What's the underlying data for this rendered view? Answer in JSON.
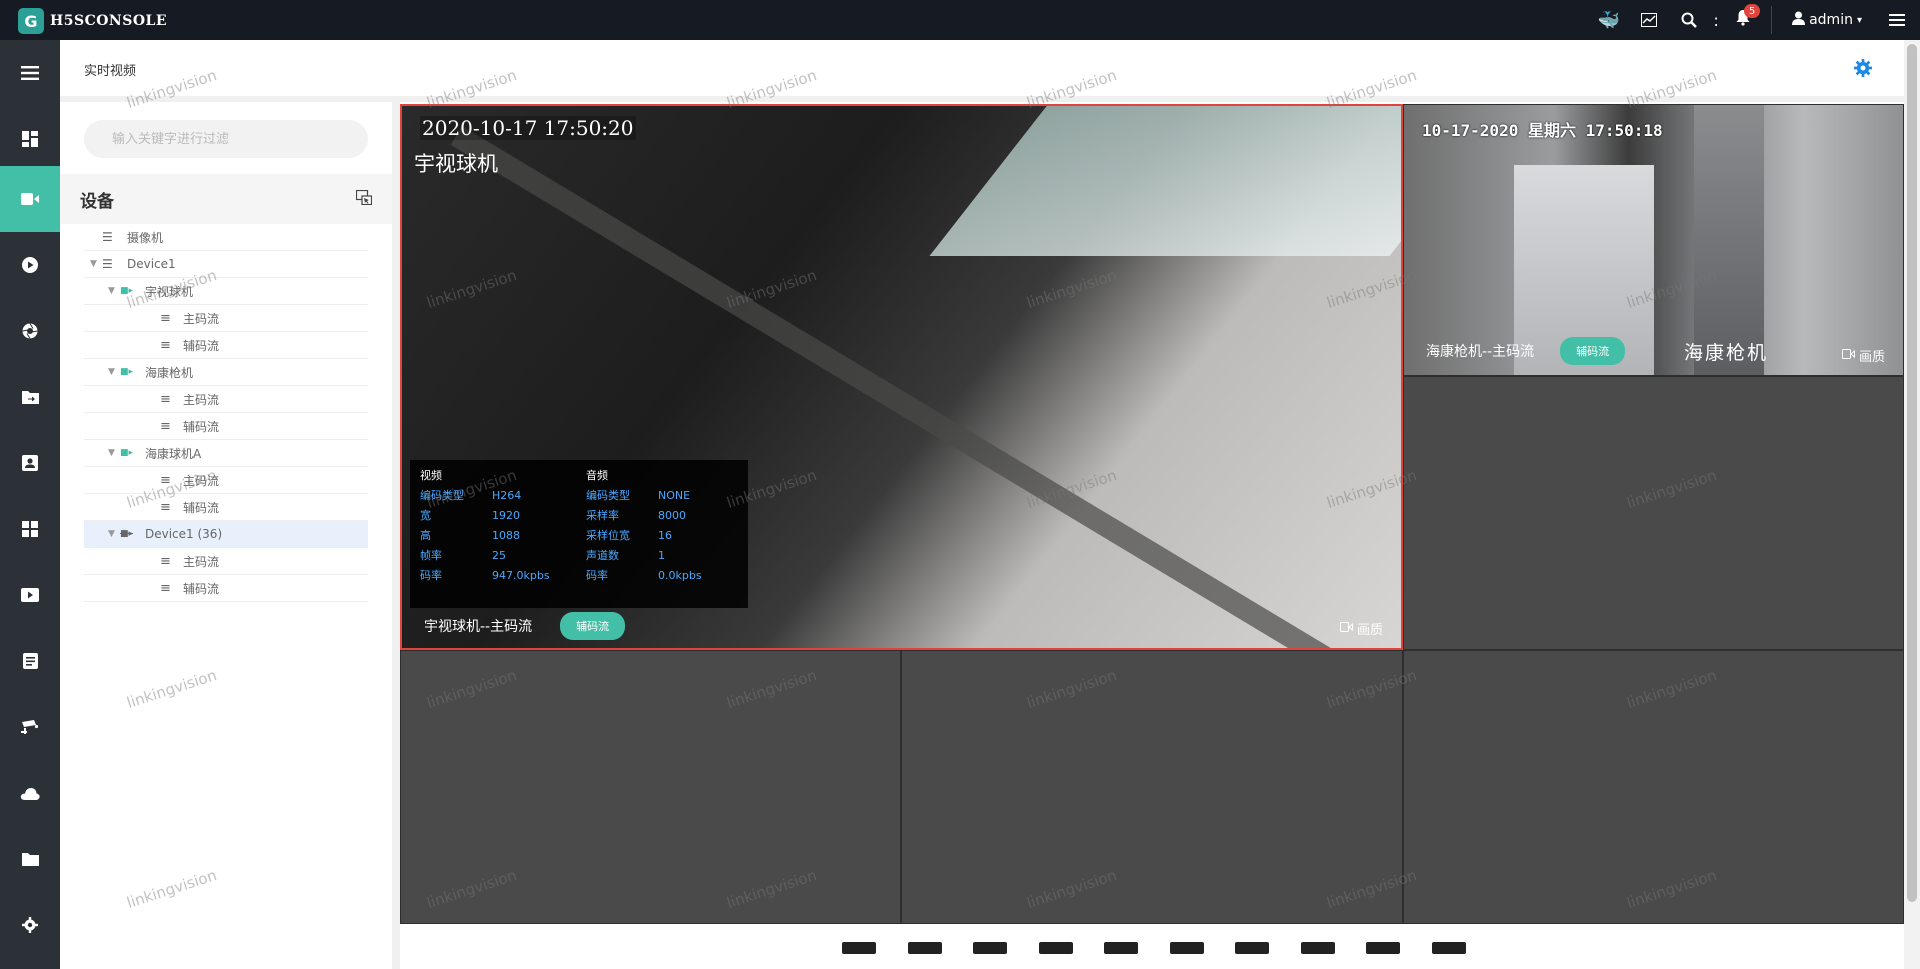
{
  "app": {
    "brand": "H5SCONSOLE",
    "logo_glyph": "G"
  },
  "topbar": {
    "notification_count": "5",
    "user": "admin",
    "user_caret": "▾",
    "icons": [
      "docker-icon",
      "chart-icon",
      "search-icon",
      "more-vertical-icon",
      "bell-icon",
      "user-icon",
      "menu-icon"
    ]
  },
  "nav": {
    "items": [
      "menu-toggle-icon",
      "dashboard-icon",
      "live-video-icon",
      "playback-icon",
      "camera-shutter-icon",
      "folder-in-icon",
      "contact-icon",
      "grid-icon",
      "video-icon",
      "list-icon",
      "security-camera-icon",
      "cloud-icon",
      "folder-icon",
      "settings-icon"
    ],
    "active_index": 2
  },
  "page": {
    "title": "实时视频"
  },
  "side": {
    "search_placeholder": "输入关键字进行过滤",
    "devices_title": "设备",
    "tree": [
      {
        "level": 0,
        "type": "list",
        "label": "摄像机"
      },
      {
        "level": 0,
        "type": "list",
        "label": "Device1",
        "expandable": true
      },
      {
        "level": 1,
        "type": "camera",
        "label": "宇视球机",
        "expandable": true
      },
      {
        "level": 2,
        "type": "stream",
        "label": "主码流"
      },
      {
        "level": 2,
        "type": "stream",
        "label": "辅码流"
      },
      {
        "level": 1,
        "type": "camera",
        "label": "海康枪机",
        "expandable": true
      },
      {
        "level": 2,
        "type": "stream",
        "label": "主码流"
      },
      {
        "level": 2,
        "type": "stream",
        "label": "辅码流"
      },
      {
        "level": 1,
        "type": "camera",
        "label": "海康球机A",
        "expandable": true
      },
      {
        "level": 2,
        "type": "stream",
        "label": "主码流"
      },
      {
        "level": 2,
        "type": "stream",
        "label": "辅码流"
      },
      {
        "level": 1,
        "type": "camera-off",
        "label": "Device1 (36)",
        "expandable": true,
        "highlighted": true
      },
      {
        "level": 2,
        "type": "stream",
        "label": "主码流"
      },
      {
        "level": 2,
        "type": "stream",
        "label": "辅码流"
      }
    ]
  },
  "main_video": {
    "osd_time": "2020-10-17 17:50:20",
    "osd_name": "宇视球机",
    "caption": "宇视球机--主码流",
    "sub_stream_btn": "辅码流",
    "quality": "画质",
    "stats": {
      "video_title": "视频",
      "audio_title": "音频",
      "video_rows": [
        {
          "k": "编码类型",
          "v": "H264"
        },
        {
          "k": "宽",
          "v": "1920"
        },
        {
          "k": "高",
          "v": "1088"
        },
        {
          "k": "帧率",
          "v": "25"
        },
        {
          "k": "码率",
          "v": "947.0kpbs"
        }
      ],
      "audio_rows": [
        {
          "k": "编码类型",
          "v": "NONE"
        },
        {
          "k": "采样率",
          "v": "8000"
        },
        {
          "k": "采样位宽",
          "v": "16"
        },
        {
          "k": "声道数",
          "v": "1"
        },
        {
          "k": "码率",
          "v": "0.0kpbs"
        }
      ]
    }
  },
  "side_video": {
    "osd_time": "10-17-2020 星期六 17:50:18",
    "caption": "海康枪机--主码流",
    "sub_stream_btn": "辅码流",
    "osd_name": "海康枪机",
    "quality": "画质"
  },
  "watermark": "linkingvision",
  "layout_options_count": 10,
  "colors": {
    "accent": "#43bfa7",
    "selected_border": "#e0443d",
    "nav_bg": "#2c3138",
    "topbar_bg": "#161a22",
    "link_blue": "#4aa8ff"
  }
}
